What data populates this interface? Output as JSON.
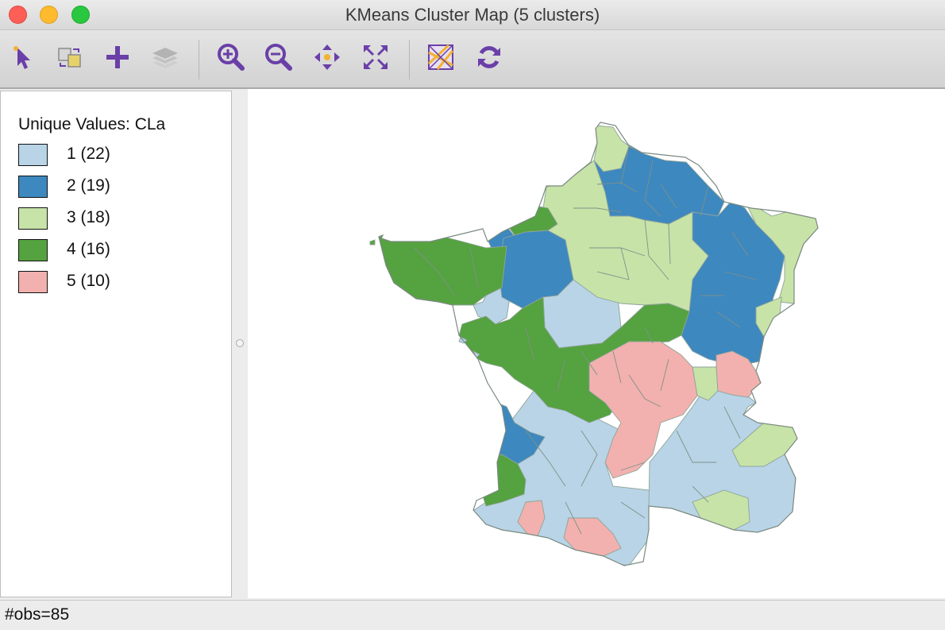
{
  "window": {
    "title": "KMeans Cluster Map (5 clusters)"
  },
  "toolbar": {
    "tools": [
      {
        "name": "select-tool",
        "icon": "pointer-arrow-icon"
      },
      {
        "name": "select-swap-tool",
        "icon": "selection-swap-icon"
      },
      {
        "name": "add-layer-tool",
        "icon": "plus-icon"
      },
      {
        "name": "layers-tool",
        "icon": "layers-icon",
        "disabled": true
      },
      {
        "name": "zoom-in-tool",
        "icon": "zoom-in-icon"
      },
      {
        "name": "zoom-out-tool",
        "icon": "zoom-out-icon"
      },
      {
        "name": "pan-tool",
        "icon": "pan-arrows-icon"
      },
      {
        "name": "full-extent-tool",
        "icon": "full-extent-icon"
      },
      {
        "name": "basemap-tool",
        "icon": "basemap-icon"
      },
      {
        "name": "refresh-tool",
        "icon": "refresh-icon"
      }
    ],
    "accent_color": "#6a3fa8"
  },
  "legend": {
    "title": "Unique Values: CLa",
    "items": [
      {
        "label": "1 (22)",
        "color": "#b8d4e6"
      },
      {
        "label": "2 (19)",
        "color": "#3d88bf"
      },
      {
        "label": "3 (18)",
        "color": "#c7e3a8"
      },
      {
        "label": "4 (16)",
        "color": "#55a240"
      },
      {
        "label": "5 (10)",
        "color": "#f2b1ae"
      }
    ]
  },
  "map": {
    "region": "France",
    "layer": "departments",
    "cluster_count": 5,
    "observations": 85
  },
  "status": {
    "text": "#obs=85"
  }
}
